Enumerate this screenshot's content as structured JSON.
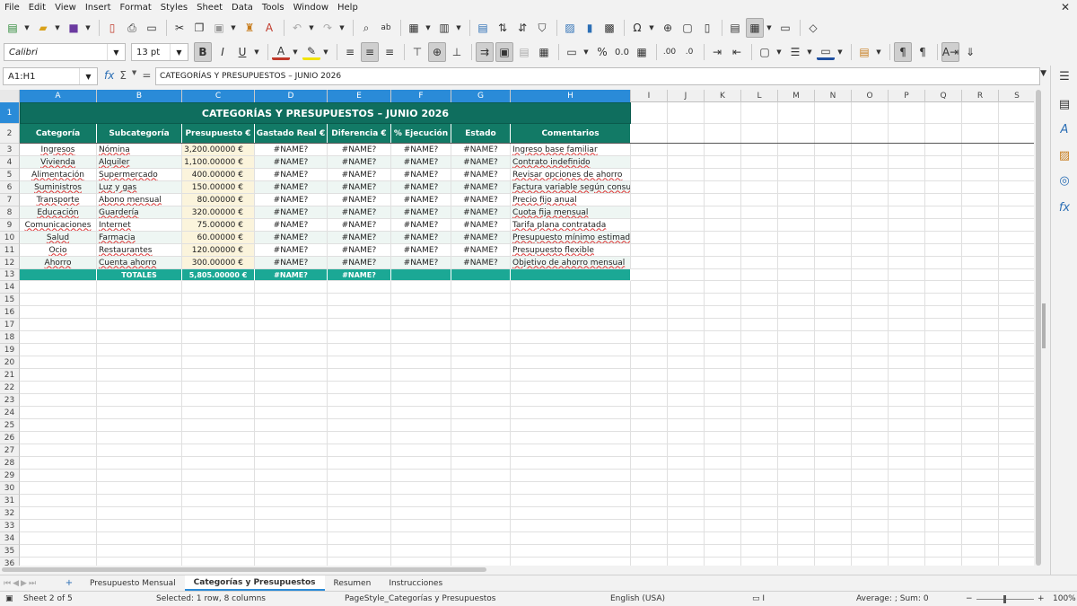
{
  "menubar": {
    "items": [
      "File",
      "Edit",
      "View",
      "Insert",
      "Format",
      "Styles",
      "Sheet",
      "Data",
      "Tools",
      "Window",
      "Help"
    ],
    "close": "✕"
  },
  "toolbar": {
    "font_name": "Calibri",
    "font_size": "13 pt"
  },
  "formula_bar": {
    "cell_ref": "A1:H1",
    "content": "CATEGORÍAS Y PRESUPUESTOS – JUNIO 2026"
  },
  "columns": [
    "A",
    "B",
    "C",
    "D",
    "E",
    "F",
    "G",
    "H",
    "I",
    "J",
    "K",
    "L",
    "M",
    "N",
    "O",
    "P",
    "Q",
    "R",
    "S"
  ],
  "rows": [
    "1",
    "2",
    "3",
    "4",
    "5",
    "6",
    "7",
    "8",
    "9",
    "10",
    "11",
    "12",
    "13",
    "14",
    "15",
    "16",
    "17",
    "18",
    "19",
    "20",
    "21",
    "22",
    "23",
    "24",
    "25",
    "26",
    "27",
    "28",
    "29",
    "30",
    "31",
    "32",
    "33",
    "34",
    "35",
    "36"
  ],
  "sheet": {
    "title": "CATEGORÍAS Y PRESUPUESTOS – JUNIO 2026",
    "headers": [
      "Categoría",
      "Subcategoría",
      "Presupuesto €",
      "Gastado Real €",
      "Diferencia €",
      "% Ejecución",
      "Estado",
      "Comentarios"
    ],
    "data_rows": [
      [
        "Ingresos",
        "Nómina",
        "3,200.00000 €",
        "#NAME?",
        "#NAME?",
        "#NAME?",
        "#NAME?",
        "Ingreso base familiar"
      ],
      [
        "Vivienda",
        "Alquiler",
        "1,100.00000 €",
        "#NAME?",
        "#NAME?",
        "#NAME?",
        "#NAME?",
        "Contrato indefinido"
      ],
      [
        "Alimentación",
        "Supermercado",
        "400.00000 €",
        "#NAME?",
        "#NAME?",
        "#NAME?",
        "#NAME?",
        "Revisar opciones de ahorro"
      ],
      [
        "Suministros",
        "Luz y gas",
        "150.00000 €",
        "#NAME?",
        "#NAME?",
        "#NAME?",
        "#NAME?",
        "Factura variable según consumo"
      ],
      [
        "Transporte",
        "Abono mensual",
        "80.00000 €",
        "#NAME?",
        "#NAME?",
        "#NAME?",
        "#NAME?",
        "Precio fijo anual"
      ],
      [
        "Educación",
        "Guardería",
        "320.00000 €",
        "#NAME?",
        "#NAME?",
        "#NAME?",
        "#NAME?",
        "Cuota fija mensual"
      ],
      [
        "Comunicaciones",
        "Internet",
        "75.00000 €",
        "#NAME?",
        "#NAME?",
        "#NAME?",
        "#NAME?",
        "Tarifa plana contratada"
      ],
      [
        "Salud",
        "Farmacia",
        "60.00000 €",
        "#NAME?",
        "#NAME?",
        "#NAME?",
        "#NAME?",
        "Presupuesto mínimo estimado"
      ],
      [
        "Ocio",
        "Restaurantes",
        "120.00000 €",
        "#NAME?",
        "#NAME?",
        "#NAME?",
        "#NAME?",
        "Presupuesto flexible"
      ],
      [
        "Ahorro",
        "Cuenta ahorro",
        "300.00000 €",
        "#NAME?",
        "#NAME?",
        "#NAME?",
        "#NAME?",
        "Objetivo de ahorro mensual"
      ]
    ],
    "totals": [
      "",
      "TOTALES",
      "5,805.00000 €",
      "#NAME?",
      "#NAME?",
      "",
      "",
      ""
    ]
  },
  "tabs": {
    "add": "+",
    "sheets": [
      "Presupuesto Mensual",
      "Categorías y Presupuestos",
      "Resumen",
      "Instrucciones"
    ],
    "active_index": 1
  },
  "status": {
    "sheet": "Sheet 2 of 5",
    "selection": "Selected: 1 row, 8 columns",
    "page_style": "PageStyle_Categorías y Presupuestos",
    "language": "English (USA)",
    "sum": "Average: ; Sum: 0",
    "zoom": "100%",
    "zoom_minus": "−",
    "zoom_plus": "+"
  },
  "colors": {
    "title_bg": "#0f6e5e",
    "header_bg": "#127a66",
    "total_bg": "#1ba895",
    "selection": "#2a8bd8"
  }
}
